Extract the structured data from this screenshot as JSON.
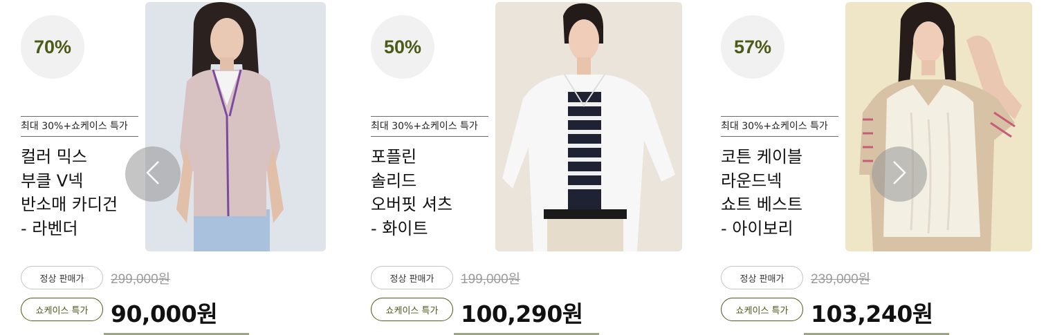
{
  "products": [
    {
      "discount": "70%",
      "promo": "최대 30%+쇼케이스 특가",
      "name_lines": [
        "컬러 믹스",
        "부클 V넥",
        "반소매 카디건",
        "- 라벤더"
      ],
      "regular_label": "정상 판매가",
      "original_price": "299,000원",
      "special_label": "쇼케이스 특가",
      "sale_price": "90,000원"
    },
    {
      "discount": "50%",
      "promo": "최대 30%+쇼케이스 특가",
      "name_lines": [
        "포플린",
        "솔리드",
        "오버핏 셔츠",
        "- 화이트"
      ],
      "regular_label": "정상 판매가",
      "original_price": "199,000원",
      "special_label": "쇼케이스 특가",
      "sale_price": "100,290원"
    },
    {
      "discount": "57%",
      "promo": "최대 30%+쇼케이스 특가",
      "name_lines": [
        "코튼 케이블",
        "라운드넥",
        "쇼트 베스트",
        "- 아이보리"
      ],
      "regular_label": "정상 판매가",
      "original_price": "239,000원",
      "special_label": "쇼케이스 특가",
      "sale_price": "103,240원"
    }
  ],
  "icons": {
    "prev": "chevron-left-icon",
    "next": "chevron-right-icon"
  },
  "colors": {
    "accent": "#4a5a17",
    "discount_bg": "#f1f1f1"
  }
}
